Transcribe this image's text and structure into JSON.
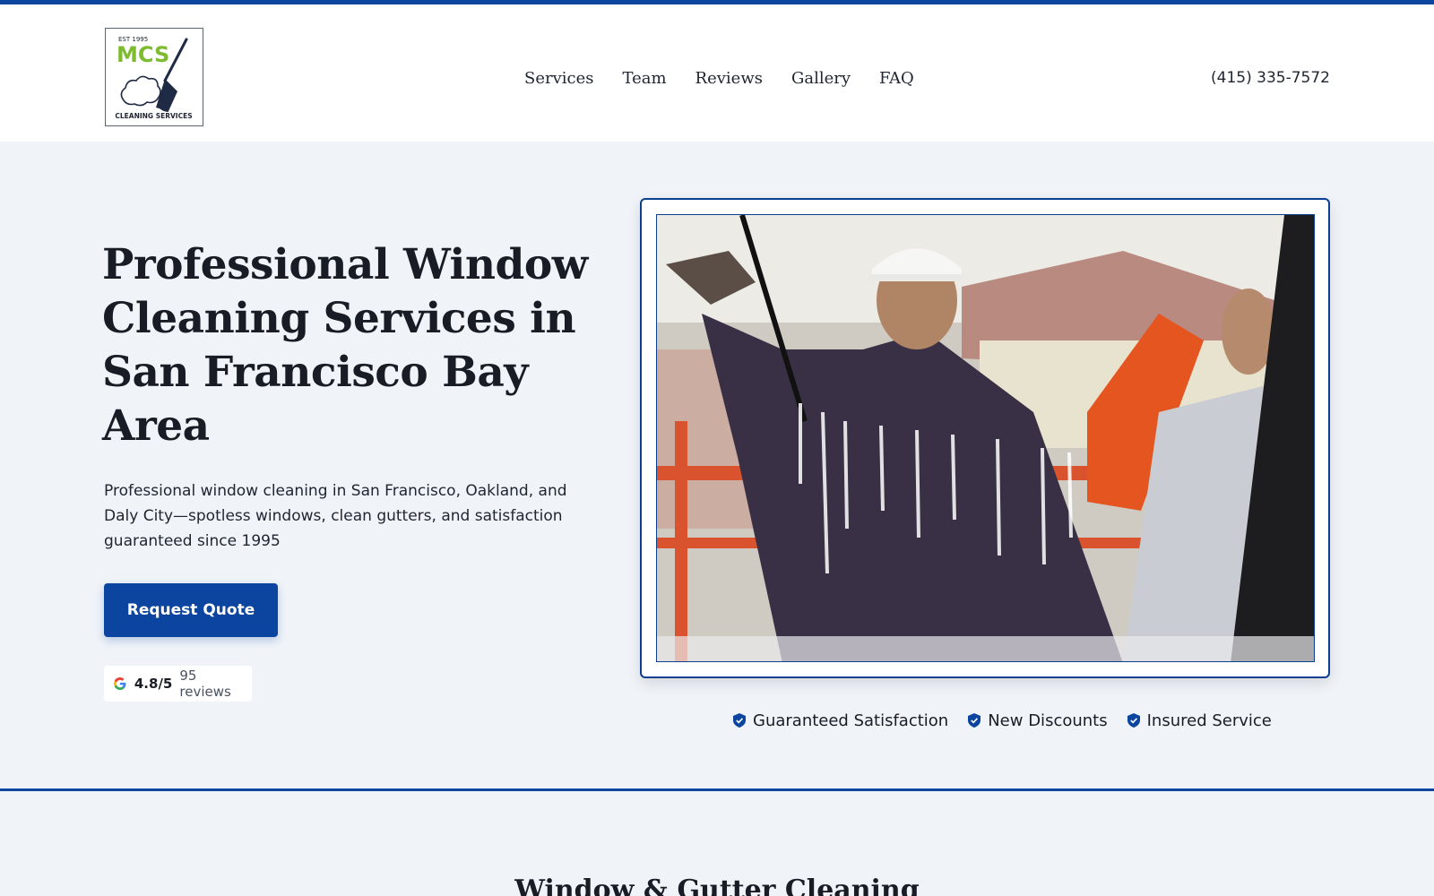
{
  "header": {
    "logo": {
      "est": "EST 1995",
      "mark": "MCS",
      "tagline": "CLEANING SERVICES"
    },
    "nav": [
      "Services",
      "Team",
      "Reviews",
      "Gallery",
      "FAQ"
    ],
    "phone": "(415) 335-7572"
  },
  "hero": {
    "title": "Professional Window Cleaning Services in San Francisco Bay Area",
    "subtitle": "Professional window cleaning in San Francisco, Oakland, and Daly City—spotless windows, clean gutters, and satisfaction guaranteed since 1995",
    "cta_label": "Request Quote",
    "rating": {
      "icon": "google-icon",
      "score": "4.8/5",
      "count": "95 reviews"
    },
    "badges": [
      {
        "icon": "shield-check-icon",
        "label": "Guaranteed Satisfaction"
      },
      {
        "icon": "shield-check-icon",
        "label": "New Discounts"
      },
      {
        "icon": "shield-check-icon",
        "label": "Insured Service"
      }
    ]
  },
  "next_section": {
    "title": "Window & Gutter Cleaning"
  },
  "colors": {
    "primary": "#0b45a0",
    "hero_bg": "#f0f4f9",
    "logo_green": "#7dbb2f"
  }
}
